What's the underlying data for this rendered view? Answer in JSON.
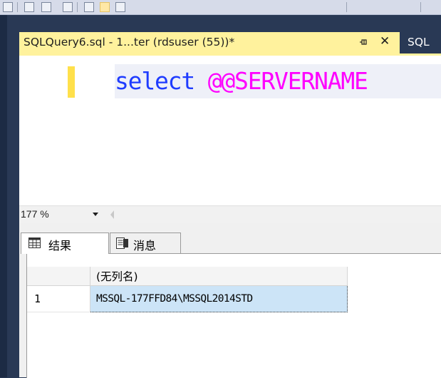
{
  "editor_tab": {
    "title": "SQLQuery6.sql - 1...ter (rdsuser (55))*",
    "next_tab_title": "SQL"
  },
  "editor": {
    "code_keyword": "select",
    "code_function": "@@SERVERNAME"
  },
  "zoom": {
    "value": "177 %"
  },
  "results_tabs": {
    "results_label": "结果",
    "messages_label": "消息"
  },
  "grid": {
    "column_header": "(无列名)",
    "rows": [
      {
        "row_number": "1",
        "value": "MSSQL-177FFD84\\MSSQL2014STD"
      }
    ]
  },
  "colors": {
    "active_tab": "#fff29d",
    "keyword": "#1f3cff",
    "function": "#ff00ff",
    "selected_cell": "#cce4f7",
    "window_chrome": "#293955"
  },
  "icons": [
    "pin-icon",
    "close-icon",
    "results-grid-icon",
    "messages-icon",
    "chevron-down-icon"
  ]
}
